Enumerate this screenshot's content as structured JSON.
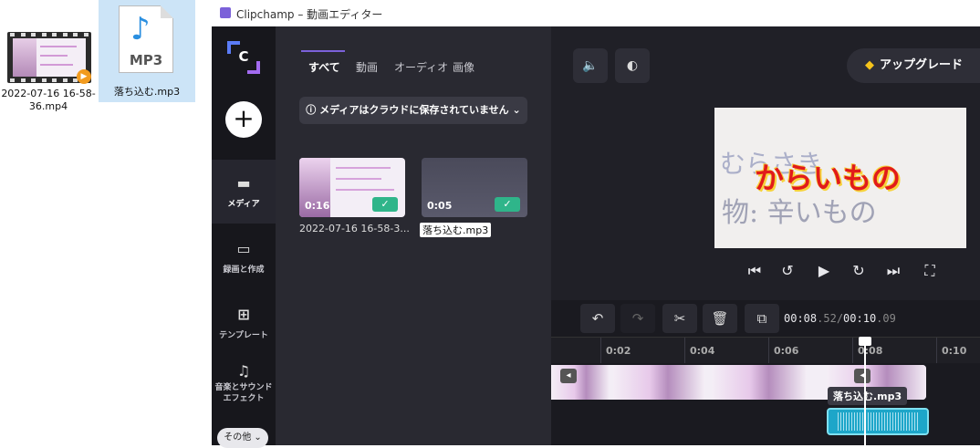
{
  "desktop": {
    "mp4_name": "2022-07-16 16-58-36.mp4",
    "mp3_name": "落ち込む.mp3",
    "mp3_badge": "MP3"
  },
  "app": {
    "title": "Clipchamp – 動画エディター",
    "brand_letter": "C"
  },
  "nav": {
    "add": "+",
    "items": [
      {
        "label": "メディア",
        "icon": "folder-icon"
      },
      {
        "label": "録画と作成",
        "icon": "video-camera-icon"
      },
      {
        "label": "テンプレート",
        "icon": "template-icon"
      },
      {
        "label": "音楽とサウンド エフェクト",
        "icon": "music-note-icon"
      }
    ],
    "more": "その他 ⌄"
  },
  "media": {
    "tabs": [
      "すべて",
      "動画",
      "オーディオ",
      "画像"
    ],
    "cloud_notice": "ⓘ  メディアはクラウドに保存されていません  ⌄",
    "items": [
      {
        "duration": "0:16",
        "label": "2022-07-16 16-58-3...",
        "check": "✓"
      },
      {
        "duration": "0:05",
        "label": "落ち込む.mp3",
        "check": "✓"
      }
    ]
  },
  "preview": {
    "upgrade": "アップグレード",
    "caption": "からいもの",
    "scribble1": "むらさき",
    "scribble2": "物: 辛いもの"
  },
  "timeline": {
    "time_current": "00:08",
    "time_current_ms": ".52",
    "time_sep": "/",
    "time_total": "00:10",
    "time_total_ms": ".09",
    "ticks": [
      "0:02",
      "0:04",
      "0:06",
      "0:08",
      "0:10"
    ],
    "audio_label": "落ち込む.mp3"
  },
  "colors": {
    "accent": "#7b61d9",
    "check": "#2fb58a",
    "audio": "#1da6c9",
    "caption": "#e11b1b"
  }
}
